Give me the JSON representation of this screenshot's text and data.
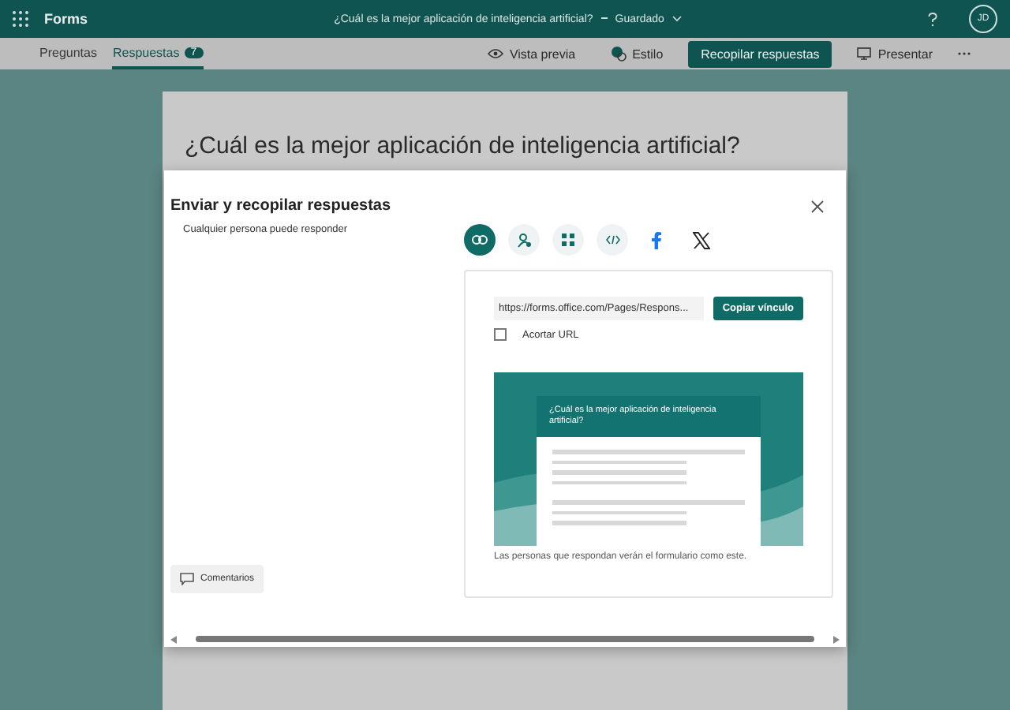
{
  "app": {
    "name": "Forms"
  },
  "header": {
    "form_title": "¿Cuál es la mejor aplicación de inteligencia artificial?",
    "save_status": "Guardado",
    "avatar_initials": "JD"
  },
  "tabs": [
    {
      "label": "Preguntas",
      "selected": false
    },
    {
      "label": "Respuestas",
      "selected": true,
      "badge": "7"
    }
  ],
  "toolbar": {
    "preview": "Vista previa",
    "style": "Estilo",
    "collect": "Recopilar respuestas",
    "present": "Presentar"
  },
  "form": {
    "title": "¿Cuál es la mejor aplicación de inteligencia artificial?"
  },
  "dialog": {
    "title": "Enviar y recopilar respuestas",
    "audience": "Cualquier persona puede responder",
    "share_options": [
      {
        "kind": "link",
        "selected": true
      },
      {
        "kind": "people",
        "selected": false
      },
      {
        "kind": "qr",
        "selected": false
      },
      {
        "kind": "embed",
        "selected": false
      },
      {
        "kind": "facebook",
        "selected": false
      },
      {
        "kind": "x",
        "selected": false
      }
    ],
    "url": "https://forms.office.com/Pages/Respons...",
    "copy_button": "Copiar vínculo",
    "shorten_url": {
      "label": "Acortar URL",
      "checked": false
    },
    "preview": {
      "title": "¿Cuál es la mejor aplicación de inteligencia artificial?"
    },
    "caption": "Las personas que respondan verán el formulario como este.",
    "comments_button": "Comentarios"
  }
}
